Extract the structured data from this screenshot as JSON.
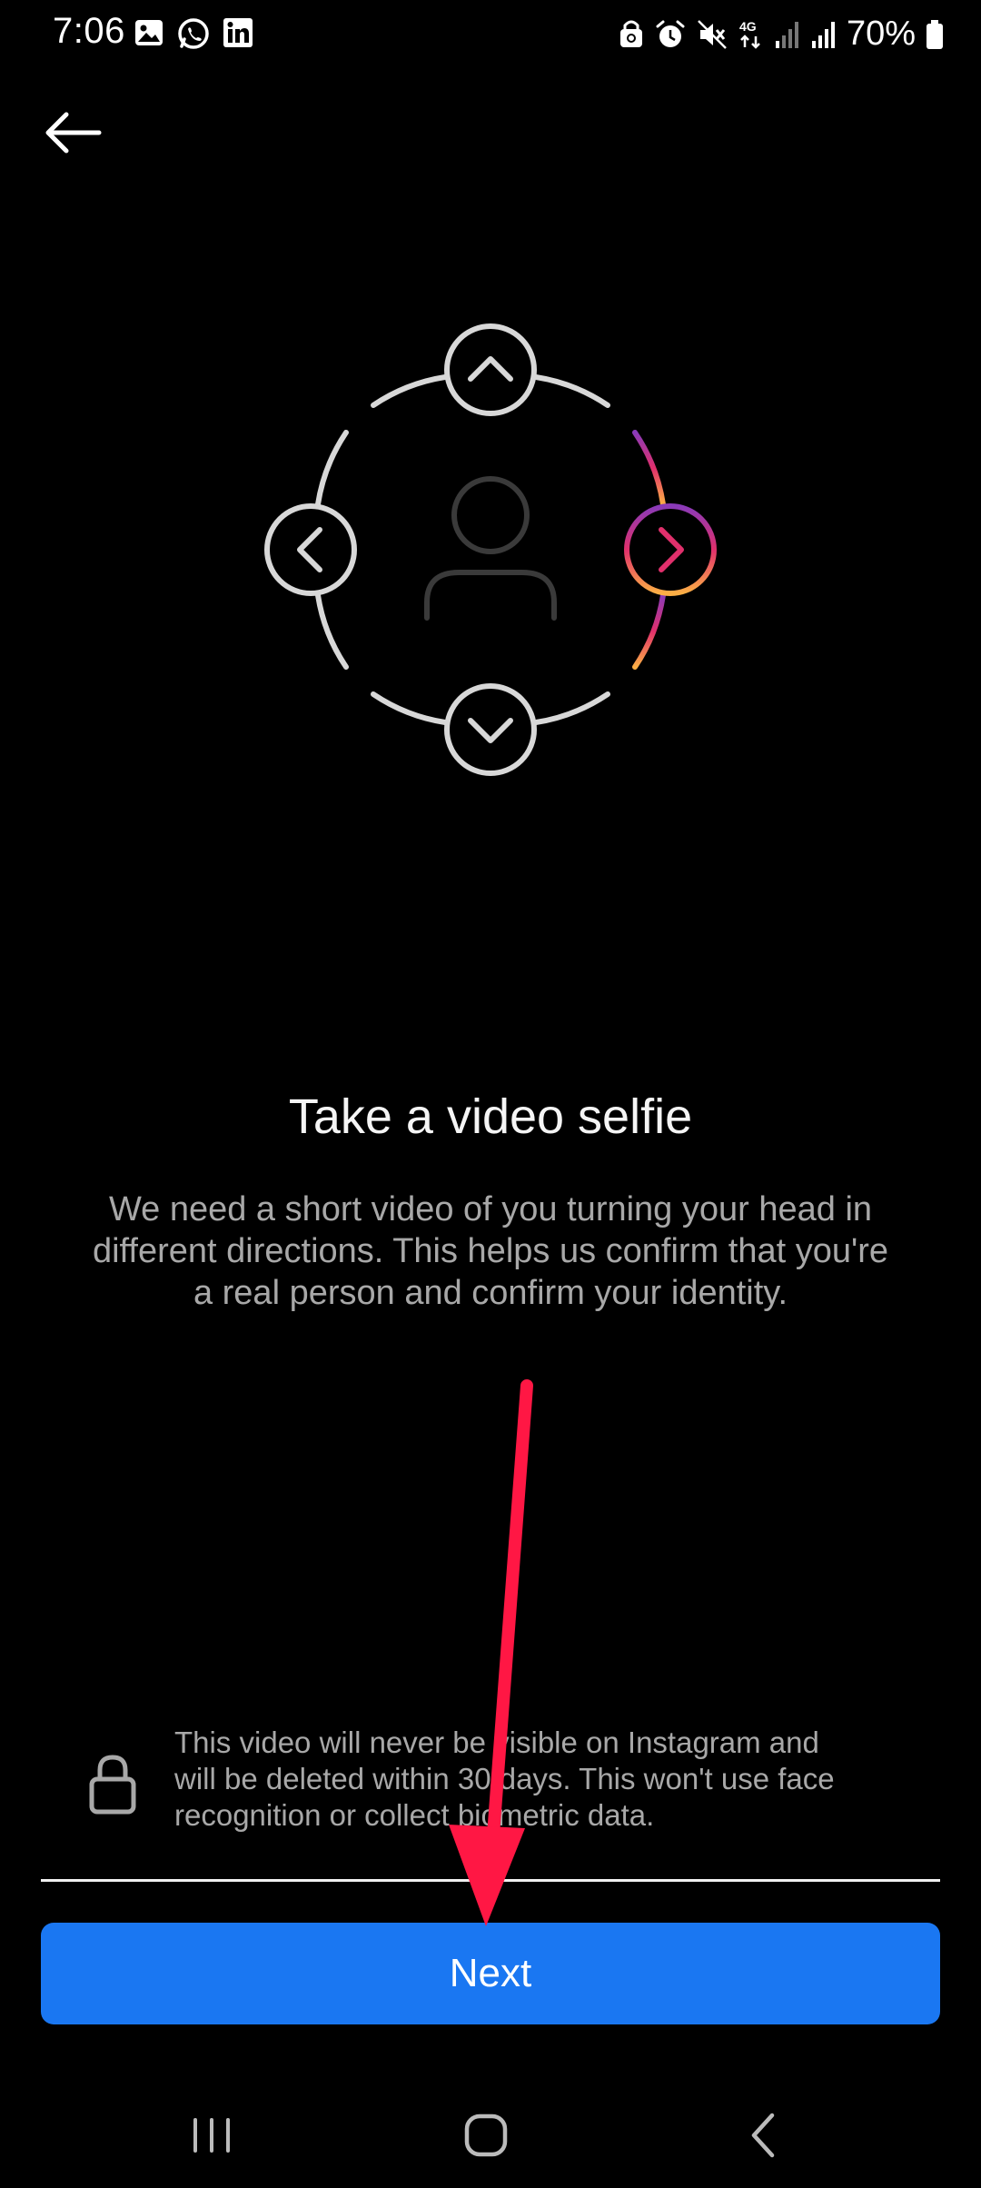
{
  "status_bar": {
    "time": "7:06",
    "battery": "70%",
    "network": "4G"
  },
  "icons": {
    "back": "arrow-left-icon",
    "person": "person-icon",
    "lock": "lock-icon"
  },
  "main": {
    "title": "Take a video selfie",
    "description": "We need a short video of you turning your head in different directions. This helps us confirm that you're a real person and confirm your identity.",
    "privacy_notice": "This video will never be visible on Instagram and will be deleted within 30 days. This won't use face recognition or collect biometric data."
  },
  "actions": {
    "next_label": "Next"
  },
  "colors": {
    "background": "#000000",
    "button_blue": "#1a77f2",
    "annotation_red": "#ff1744",
    "gradient_start": "#8a3ab9",
    "gradient_mid": "#e1306c",
    "gradient_end": "#fcaf45"
  }
}
